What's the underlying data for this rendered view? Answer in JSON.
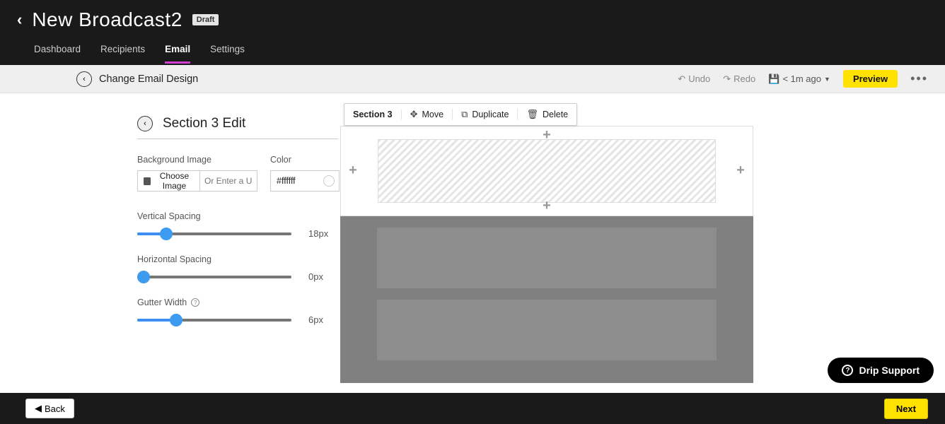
{
  "header": {
    "title": "New Broadcast2",
    "badge": "Draft",
    "tabs": [
      "Dashboard",
      "Recipients",
      "Email",
      "Settings"
    ],
    "active_tab": "Email"
  },
  "toolbar": {
    "change_design": "Change Email Design",
    "undo": "Undo",
    "redo": "Redo",
    "saved": "< 1m ago",
    "preview": "Preview"
  },
  "editor": {
    "section_title": "Section 3 Edit",
    "bg_image_label": "Background Image",
    "choose_image": "Choose Image",
    "url_placeholder": "Or Enter a U",
    "color_label": "Color",
    "color_value": "#ffffff",
    "sliders": {
      "vertical": {
        "label": "Vertical Spacing",
        "value": "18px",
        "pct": 19
      },
      "horizontal": {
        "label": "Horizontal Spacing",
        "value": "0px",
        "pct": 0
      },
      "gutter": {
        "label": "Gutter Width",
        "value": "6px",
        "pct": 25
      }
    }
  },
  "canvas_toolbar": {
    "section_label": "Section 3",
    "move": "Move",
    "duplicate": "Duplicate",
    "delete": "Delete"
  },
  "footer": {
    "back": "Back",
    "next": "Next"
  },
  "support": "Drip Support"
}
